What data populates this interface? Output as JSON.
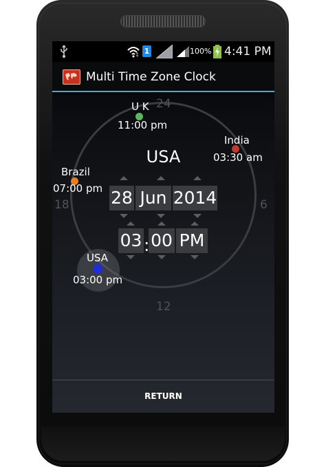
{
  "status_bar": {
    "battery_percent": "100%",
    "time": "4:41 PM",
    "notification_badge": "1",
    "icons": [
      "usb-icon",
      "wifi-icon",
      "sim-badge-icon",
      "signal-icon",
      "signal-icon",
      "battery-charging-icon"
    ]
  },
  "action_bar": {
    "title": "Multi Time Zone Clock",
    "accent_color": "#33b5e5",
    "icon": "world-map-icon"
  },
  "dial": {
    "top": "24",
    "right": "6",
    "bottom": "12",
    "left": "18"
  },
  "zones": [
    {
      "name": "U K",
      "time": "11:00 pm",
      "color": "#5cb85c"
    },
    {
      "name": "India",
      "time": "03:30 am",
      "color": "#c0392b"
    },
    {
      "name": "Brazil",
      "time": "07:00 pm",
      "color": "#e67e22"
    },
    {
      "name": "USA",
      "time": "03:00 pm",
      "color": "#1f2fd6"
    }
  ],
  "selected_zone": "USA",
  "date": {
    "day": "28",
    "month": "Jun",
    "year": "2014"
  },
  "clock_time": {
    "hour": "03",
    "separator": ":",
    "minute": "00",
    "ampm": "PM"
  },
  "return_button": "RETURN"
}
